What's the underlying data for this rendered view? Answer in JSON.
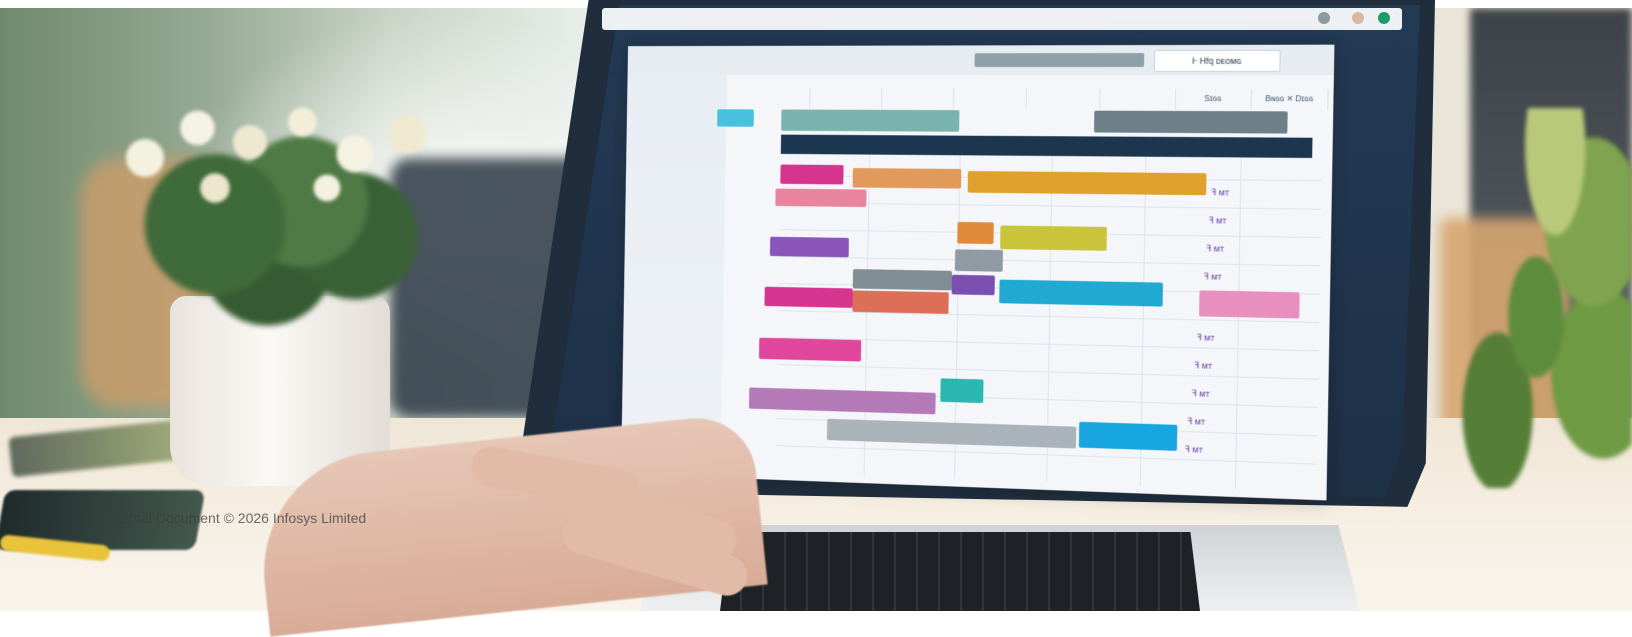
{
  "watermark": {
    "text": "xternal Document © 2026 Infosys Limited"
  },
  "app": {
    "top_button": "Ꮀ Hfq ᴅᴇᴏᴍɢ",
    "column_headers": [
      "",
      "",
      "",
      "",
      "",
      "",
      "Sɪɢɢ",
      "Bɴɢɢ ✕ Dɪɢɢ"
    ],
    "right_labels": [
      "ꟻ ᴍᴛ",
      "ꟻ ᴍᴛ",
      "ꟻ ᴍᴛ",
      "ꟻ ᴍᴛ",
      "ꟻ ᴍᴛ",
      "ꟻ ᴍᴛ",
      "ꟻ ᴍᴛ",
      "ꟻ ᴍᴛ",
      "ꟻ ᴍᴛ"
    ]
  },
  "colors": {
    "screen_bezel": "#1f2d3d",
    "dark_header_bar": "#1d3650",
    "bar_magenta": "#d6358f",
    "bar_orange": "#e19a5b",
    "bar_gold": "#e0a02c",
    "bar_purple": "#8a55b8",
    "bar_cyan": "#1fa9d3",
    "bar_pink": "#e9849f",
    "bar_gray": "#8f9aa3"
  }
}
